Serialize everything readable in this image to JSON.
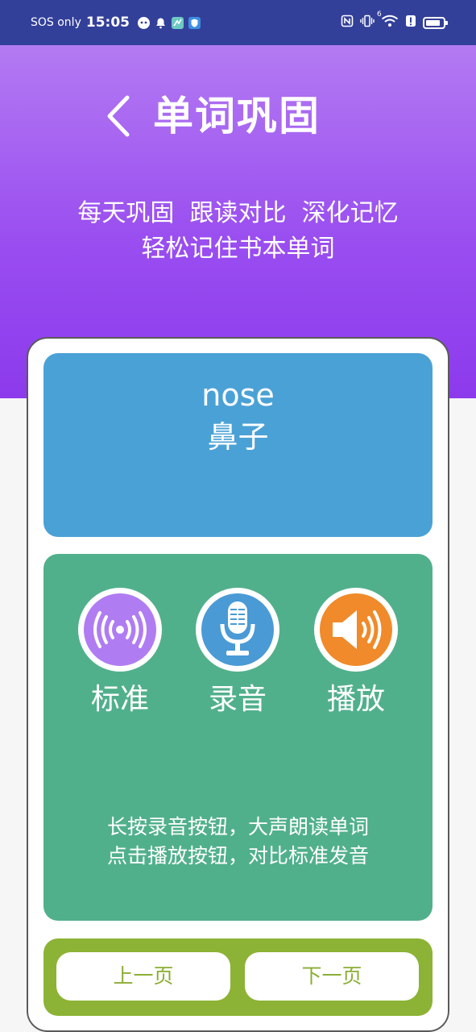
{
  "status_bar": {
    "carrier": "SOS only",
    "time": "15:05",
    "network_label": "6"
  },
  "header": {
    "title": "单词巩固",
    "subtitle_line1": "每天巩固  跟读对比  深化记忆",
    "subtitle_line2": "轻松记住书本单词"
  },
  "word": {
    "english": "nose",
    "chinese": "鼻子"
  },
  "controls": {
    "standard_label": "标准",
    "record_label": "录音",
    "play_label": "播放"
  },
  "hints": {
    "line1": "长按录音按钮，大声朗读单词",
    "line2": "点击播放按钮，对比标准发音"
  },
  "navigation": {
    "prev_label": "上一页",
    "next_label": "下一页"
  },
  "colors": {
    "status_bar": "#33409a",
    "hero_top": "#b37af2",
    "hero_bottom": "#8c3aec",
    "word_panel": "#4aa1d6",
    "record_panel": "#51b08c",
    "nav_panel": "#8cb335",
    "standard_icon": "#b07cf2",
    "record_icon": "#4a9ad6",
    "play_icon": "#f08a2a"
  },
  "icons": {
    "standard": "signal-broadcast-icon",
    "record": "microphone-icon",
    "play": "speaker-icon"
  }
}
